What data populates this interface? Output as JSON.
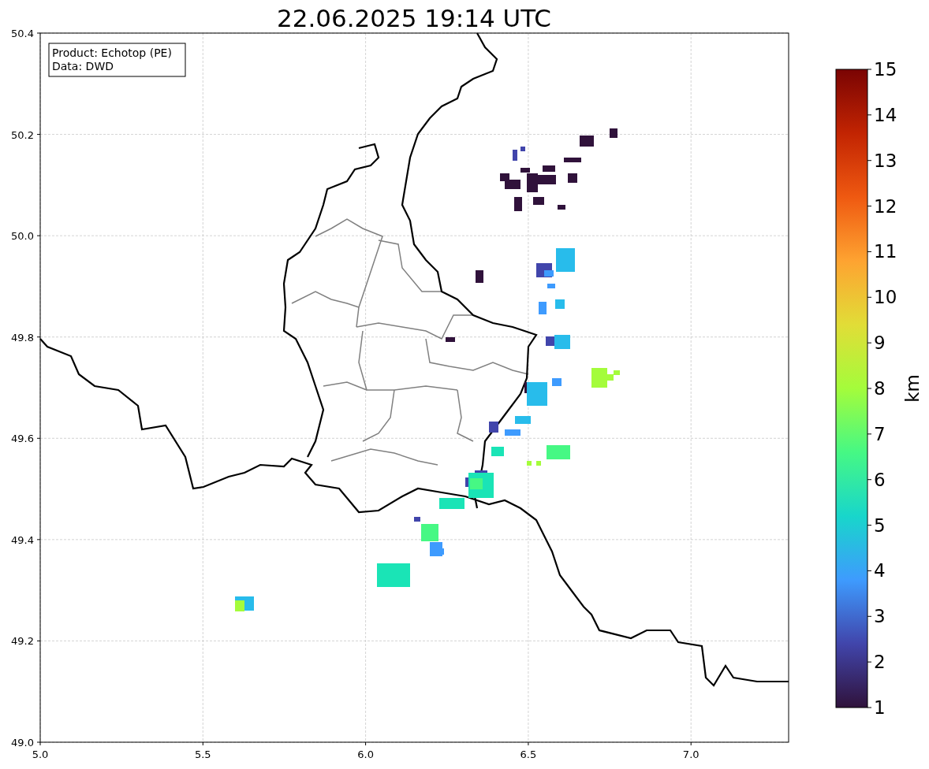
{
  "title": "22.06.2025 19:14 UTC",
  "info_box": [
    "Product: Echotop (PE)",
    "Data: DWD"
  ],
  "map": {
    "x_tick_labels": [
      "5.0",
      "5.5",
      "6.0",
      "6.5",
      "7.0"
    ],
    "y_tick_labels": [
      "50.4",
      "50.2",
      "50.0",
      "49.8",
      "49.6",
      "49.4",
      "49.2",
      "49.0"
    ]
  },
  "colorbar": {
    "label": "km",
    "tick_labels": [
      "15",
      "14",
      "13",
      "12",
      "11",
      "10",
      "9",
      "8",
      "7",
      "6",
      "5",
      "4",
      "3",
      "2",
      "1"
    ]
  }
}
